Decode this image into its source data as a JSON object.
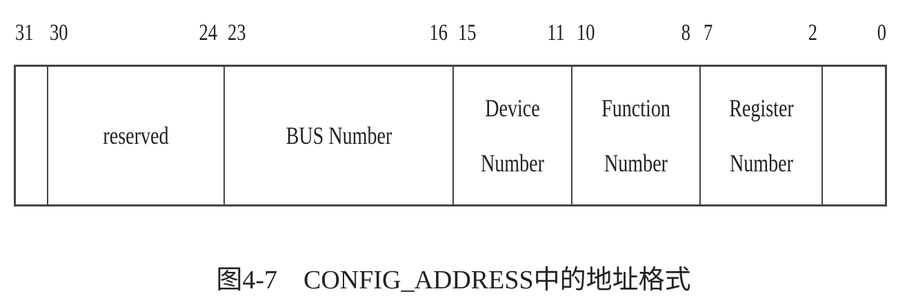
{
  "bit_labels": {
    "b31": "31",
    "b30": "30",
    "b24": "24",
    "b23": "23",
    "b16": "16",
    "b15": "15",
    "b11": "11",
    "b10": "10",
    "b8": "8",
    "b7": "7",
    "b2": "2",
    "b0": "0"
  },
  "fields": {
    "enable": "",
    "reserved": "reserved",
    "bus_number": "BUS Number",
    "device_number": "Device\nNumber",
    "function_number": "Function\nNumber",
    "register_number": "Register\nNumber",
    "low_bits": ""
  },
  "caption": "图4-7    CONFIG_ADDRESS中的地址格式"
}
